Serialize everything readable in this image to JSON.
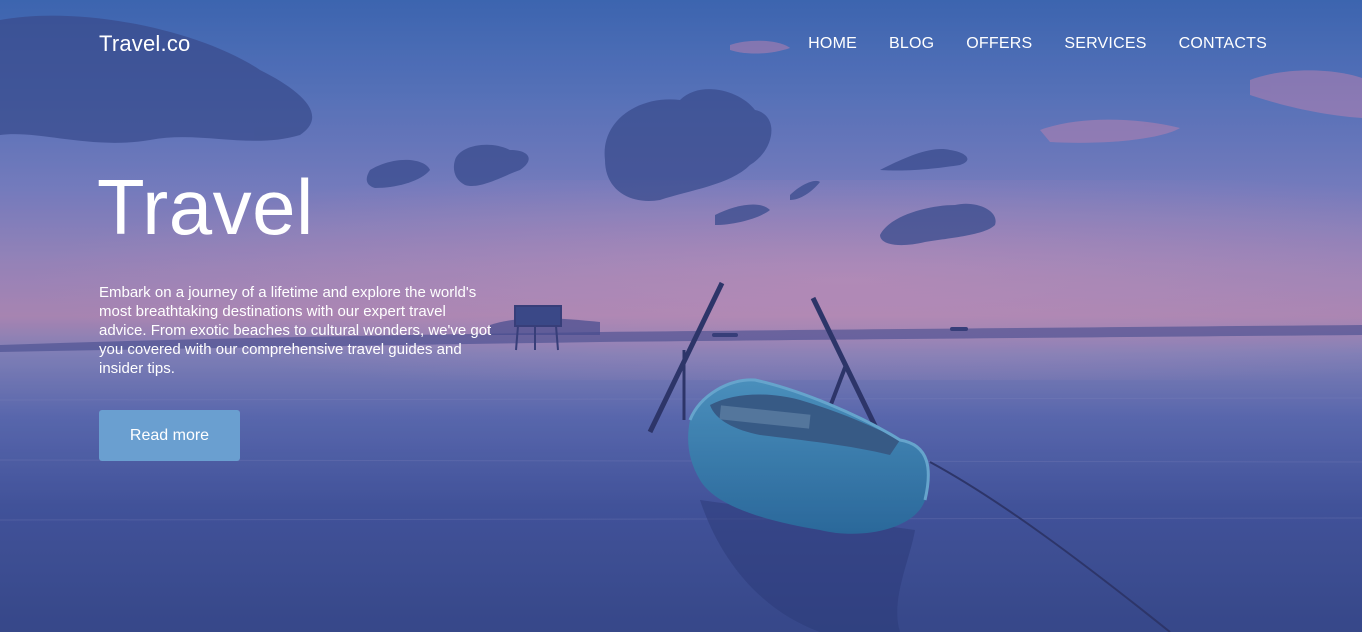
{
  "brand": {
    "name": "Travel.co"
  },
  "nav": {
    "items": [
      {
        "label": "HOME"
      },
      {
        "label": "BLOG"
      },
      {
        "label": "OFFERS"
      },
      {
        "label": "SERVICES"
      },
      {
        "label": "CONTACTS"
      }
    ]
  },
  "hero": {
    "title": "Travel",
    "description": "Embark on a journey of a lifetime and explore the world's most breathtaking destinations with our expert travel advice. From exotic beaches to cultural wonders, we've got you covered with our comprehensive travel guides and insider tips.",
    "cta_label": "Read more"
  },
  "colors": {
    "button": "#6a9fd0",
    "text": "#ffffff",
    "sky_top": "#3f6bb6",
    "sunset_pink": "#b98fb8",
    "water": "#394a8a"
  }
}
